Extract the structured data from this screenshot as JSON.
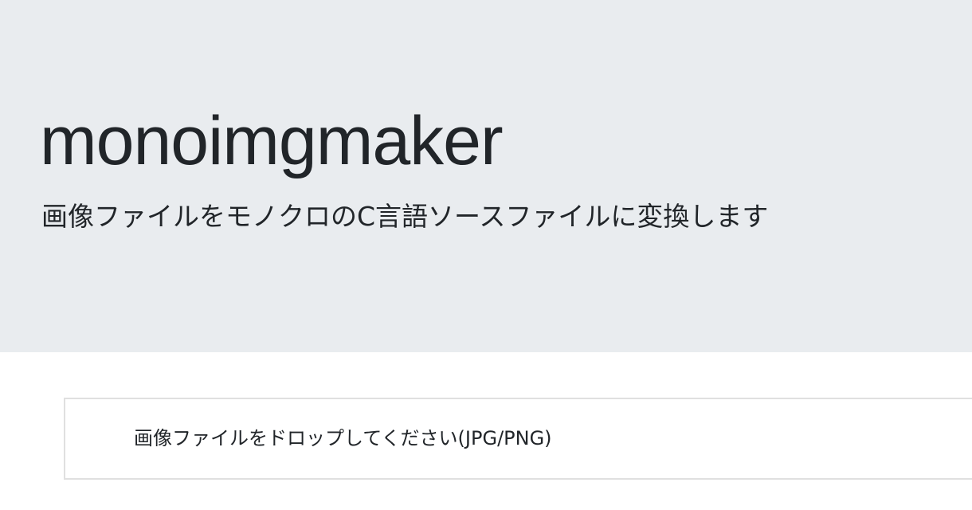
{
  "header": {
    "title": "monoimgmaker",
    "subtitle": "画像ファイルをモノクロのC言語ソースファイルに変換します"
  },
  "dropzone": {
    "label": "画像ファイルをドロップしてください(JPG/PNG)"
  },
  "colors": {
    "header_background": "#e9ecef",
    "page_background": "#ffffff",
    "text": "#212529",
    "dropzone_border": "#e0e0e0"
  }
}
